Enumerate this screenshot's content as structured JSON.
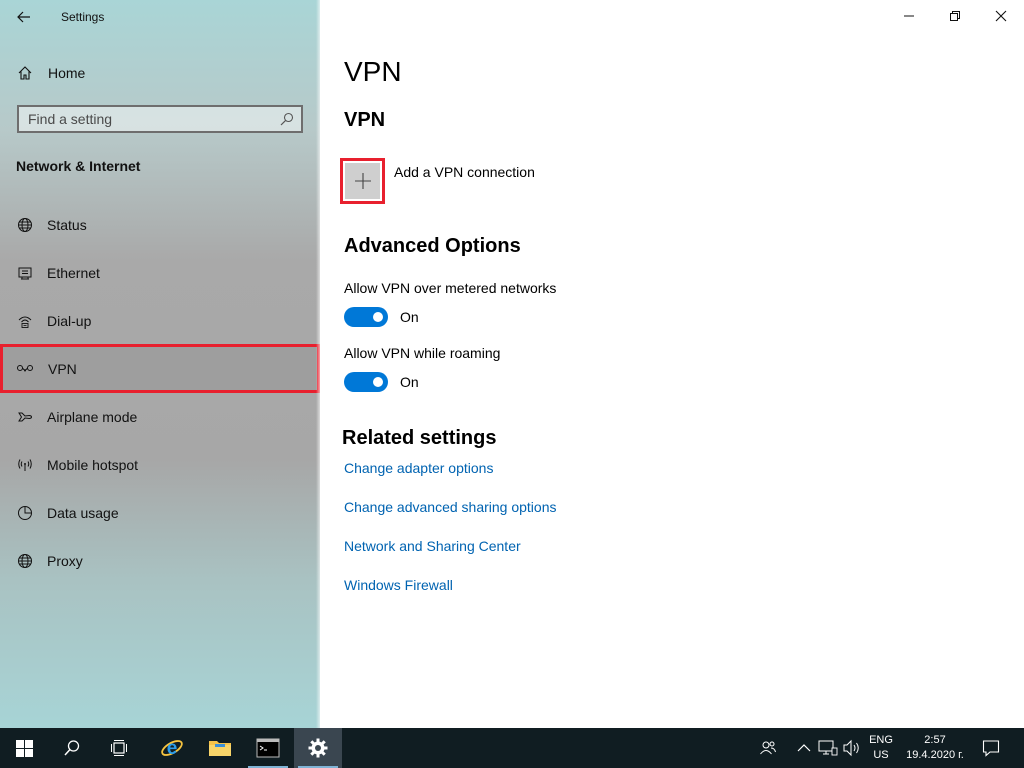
{
  "window": {
    "title": "Settings"
  },
  "sidebar": {
    "home_label": "Home",
    "search_placeholder": "Find a setting",
    "section_title": "Network & Internet",
    "items": [
      {
        "label": "Status",
        "icon": "globe-icon"
      },
      {
        "label": "Ethernet",
        "icon": "ethernet-icon"
      },
      {
        "label": "Dial-up",
        "icon": "dialup-icon"
      },
      {
        "label": "VPN",
        "icon": "vpn-icon"
      },
      {
        "label": "Airplane mode",
        "icon": "airplane-icon"
      },
      {
        "label": "Mobile hotspot",
        "icon": "hotspot-icon"
      },
      {
        "label": "Data usage",
        "icon": "data-usage-icon"
      },
      {
        "label": "Proxy",
        "icon": "globe-icon"
      }
    ],
    "active_item": "VPN"
  },
  "main": {
    "page_title": "VPN",
    "vpn_section_title": "VPN",
    "add_vpn_label": "Add a VPN connection",
    "advanced_title": "Advanced Options",
    "options": [
      {
        "label": "Allow VPN over metered networks",
        "state": "On"
      },
      {
        "label": "Allow VPN while roaming",
        "state": "On"
      }
    ],
    "related_title": "Related settings",
    "links": [
      "Change adapter options",
      "Change advanced sharing options",
      "Network and Sharing Center",
      "Windows Firewall"
    ]
  },
  "taskbar": {
    "language_top": "ENG",
    "language_bottom": "US",
    "time": "2:57",
    "date": "19.4.2020 г."
  },
  "colors": {
    "accent": "#0078d7",
    "link": "#0063b1",
    "highlight_border": "#e8202e",
    "taskbar": "#101d22"
  }
}
